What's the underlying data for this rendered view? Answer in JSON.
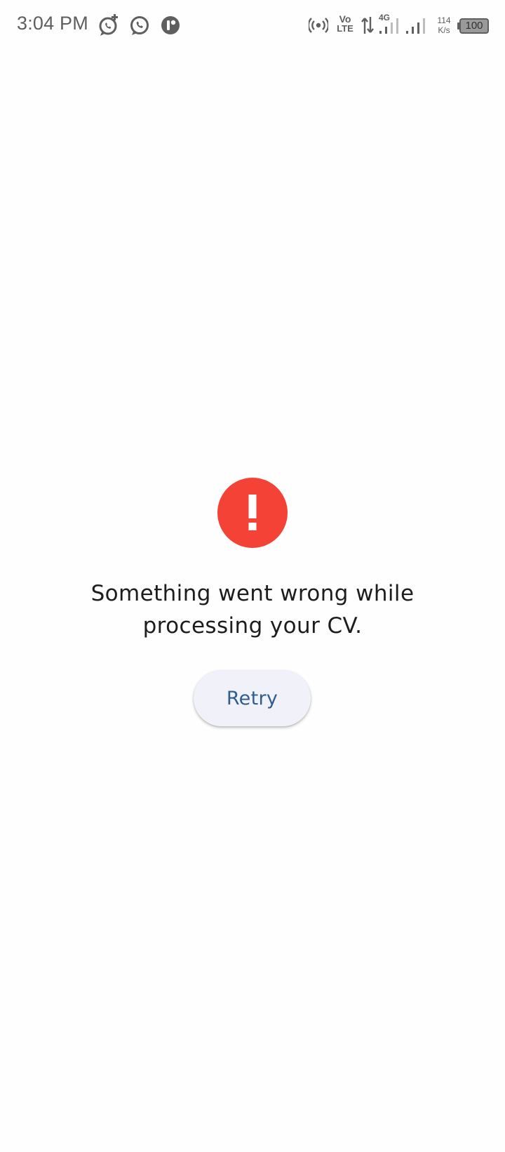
{
  "status_bar": {
    "time": "3:04 PM",
    "network_type": "4G",
    "volte_top": "Vo",
    "volte_bottom": "LTE",
    "speed_value": "114",
    "speed_unit": "K/s",
    "battery_level": "100",
    "icons": [
      "whatsapp-business-icon",
      "whatsapp-icon",
      "truecaller-icon",
      "hotspot-icon",
      "volte-icon",
      "data-arrows-icon",
      "signal-4g-icon",
      "signal-icon",
      "battery-icon"
    ]
  },
  "error": {
    "icon": "error-exclamation-icon",
    "icon_color": "#f44336",
    "message": "Something went wrong while processing your CV."
  },
  "actions": {
    "retry_label": "Retry",
    "retry_text_color": "#2f5d8e",
    "retry_bg_color": "#f0f1f9"
  }
}
